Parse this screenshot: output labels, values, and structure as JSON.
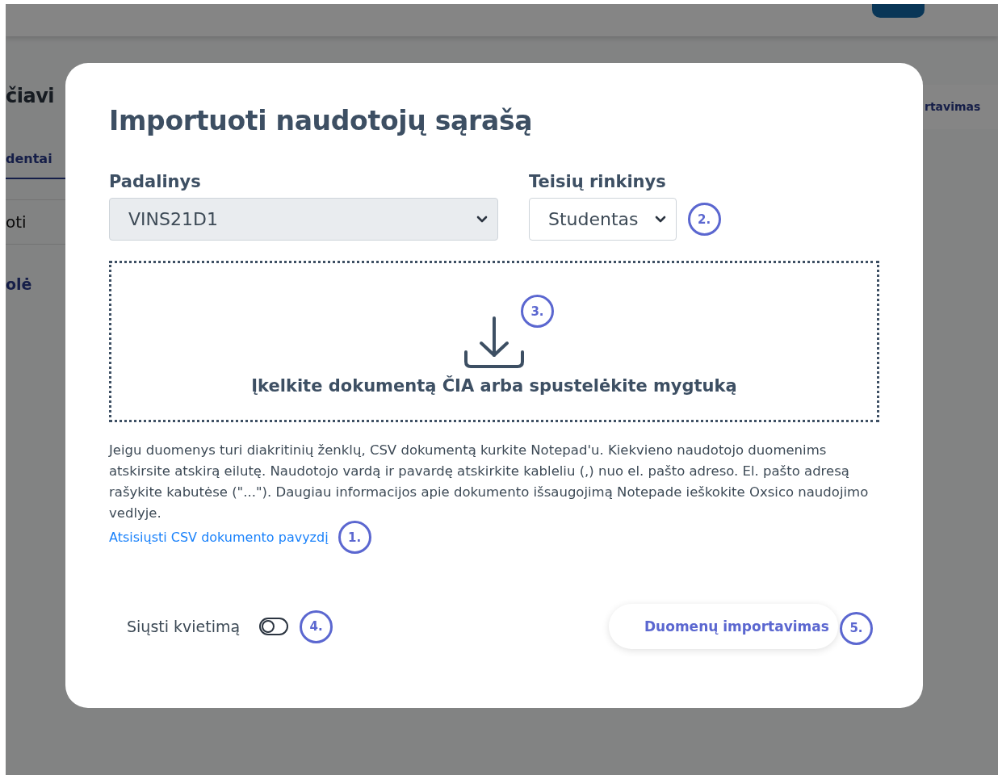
{
  "background": {
    "heading": "čiavi",
    "tab": {
      "label": "dentai",
      "selected": true
    },
    "field": {
      "value": "oti"
    },
    "link": "olė",
    "button": "rtavimas"
  },
  "modal": {
    "title": "Importuoti naudotojų sąrašą",
    "fields": [
      {
        "label": "Padalinys",
        "value": "VINS21D1",
        "disabled": true
      },
      {
        "label": "Teisių rinkinys",
        "value": "Studentas",
        "disabled": false,
        "step": "2."
      }
    ],
    "dropzone": {
      "text": "Įkelkite dokumentą ČIA arba spustelėkite mygtuką",
      "step": "3."
    },
    "help_text": "Jeigu duomenys turi diakritinių ženklų, CSV dokumentą kurkite Notepad'u. Kiekvieno naudotojo duomenims atskirsite atskirą eilutę. Naudotojo vardą ir pavardę atskirkite kableliu (,) nuo el. pašto adreso. El. pašto adresą rašykite kabutėse (\"...\"). Daugiau informacijos apie dokumento išsaugojimą Notepade ieškokite Oxsico naudojimo vedlyje.",
    "sample_link": {
      "label": "Atsisiųsti CSV dokumento pavyzdį",
      "step": "1."
    },
    "invite": {
      "label": "Siųsti kvietimą",
      "on": false,
      "step": "4."
    },
    "import_button": {
      "label": "Duomenų importavimas",
      "step": "5."
    }
  }
}
